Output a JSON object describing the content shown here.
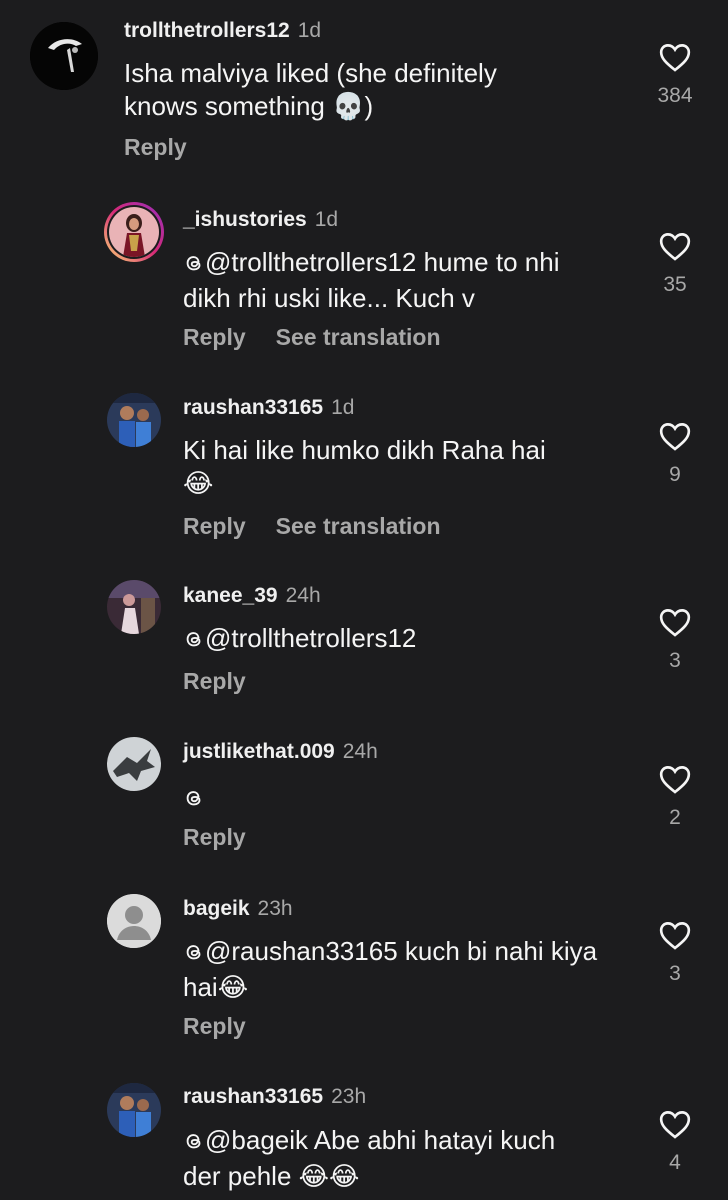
{
  "comments": [
    {
      "username": "trollthetrollers12",
      "time": "1d",
      "text": "Isha malviya liked (she definitely",
      "text2": "knows something",
      "emoji": "💀",
      "text2_tail": ")",
      "reply": "Reply",
      "likes": "384"
    },
    {
      "username": "_ishustories",
      "time": "1d",
      "mention": "@trollthetrollers12",
      "text": " hume to nhi",
      "text2": "dikh rhi uski like... Kuch v",
      "reply": "Reply",
      "translate": "See translation",
      "likes": "35"
    },
    {
      "username": "raushan33165",
      "time": "1d",
      "text": "Ki hai like humko dikh Raha hai",
      "emoji": "😂",
      "reply": "Reply",
      "translate": "See translation",
      "likes": "9"
    },
    {
      "username": "kanee_39",
      "time": "24h",
      "mention": "@trollthetrollers12",
      "reply": "Reply",
      "likes": "3"
    },
    {
      "username": "justlikethat.009",
      "time": "24h",
      "reply": "Reply",
      "likes": "2"
    },
    {
      "username": "bageik",
      "time": "23h",
      "mention": "@raushan33165",
      "text": " kuch bi nahi kiya",
      "text2": "hai",
      "emoji": "😂",
      "reply": "Reply",
      "likes": "3"
    },
    {
      "username": "raushan33165",
      "time": "23h",
      "mention": "@bageik",
      "text": " Abe abhi hatayi kuch",
      "text2": "der pehle ",
      "emoji": "😂😂",
      "likes": "4"
    }
  ],
  "colors": {
    "background": "#1c1c1e",
    "text": "#f5f5f5",
    "muted": "#a8a8a8",
    "ring_gradient": [
      "#feda75",
      "#d62976",
      "#962fbf"
    ]
  },
  "icons": {
    "like": "heart-outline-icon",
    "threads": "threads-logo-icon"
  }
}
